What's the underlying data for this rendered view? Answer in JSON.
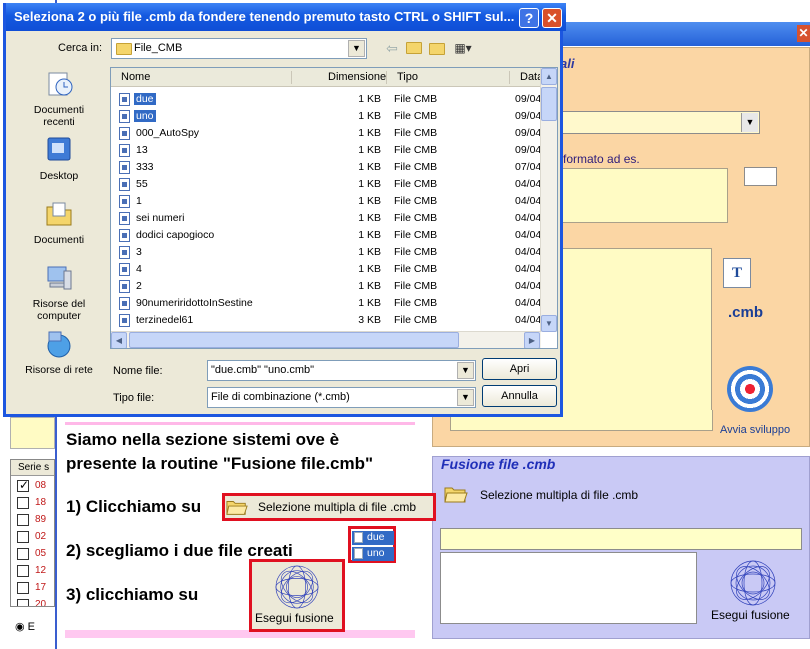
{
  "bg_app": {
    "orange_legend": "ali",
    "hint_text": "formato ad es.",
    "cmb_label": ".cmb",
    "avvia_label": "Avvia sviluppo",
    "fusione_legend": "Fusione file .cmb",
    "selezione_label": "Selezione multipla di file .cmb",
    "esegui_label": "Esegui fusione",
    "left_list_header": "Serie s",
    "left_list_rows": [
      "08",
      "18",
      "89",
      "02",
      "05",
      "12",
      "17",
      "20"
    ],
    "left_radio_label": "E"
  },
  "instructions": {
    "line1": "Siamo nella sezione sistemi ove è",
    "line2": "presente la routine \"Fusione file.cmb\"",
    "step1": "1) Clicchiamo su",
    "step1_button": "Selezione multipla di file .cmb",
    "step2": "2) scegliamo i due file creati",
    "step2_files": [
      "due",
      "uno"
    ],
    "step3": "3) clicchiamo su",
    "step3_button": "Esegui fusione"
  },
  "dialog": {
    "title": "Seleziona 2 o più file .cmb da fondere tenendo premuto tasto CTRL o SHIFT sul...",
    "cerca_label": "Cerca in:",
    "cerca_value": "File_CMB",
    "places": [
      "Documenti recenti",
      "Desktop",
      "Documenti",
      "Risorse del computer",
      "Risorse di rete"
    ],
    "columns": [
      "Nome",
      "Dimensione",
      "Tipo",
      "Data"
    ],
    "files": [
      {
        "name": "due",
        "size": "1 KB",
        "type": "File CMB",
        "date": "09/04",
        "selected": true
      },
      {
        "name": "uno",
        "size": "1 KB",
        "type": "File CMB",
        "date": "09/04",
        "selected": true
      },
      {
        "name": "000_AutoSpy",
        "size": "1 KB",
        "type": "File CMB",
        "date": "09/04",
        "selected": false
      },
      {
        "name": "13",
        "size": "1 KB",
        "type": "File CMB",
        "date": "09/04",
        "selected": false
      },
      {
        "name": "333",
        "size": "1 KB",
        "type": "File CMB",
        "date": "07/04",
        "selected": false
      },
      {
        "name": "55",
        "size": "1 KB",
        "type": "File CMB",
        "date": "04/04",
        "selected": false
      },
      {
        "name": "1",
        "size": "1 KB",
        "type": "File CMB",
        "date": "04/04",
        "selected": false
      },
      {
        "name": "sei numeri",
        "size": "1 KB",
        "type": "File CMB",
        "date": "04/04",
        "selected": false
      },
      {
        "name": "dodici capogioco",
        "size": "1 KB",
        "type": "File CMB",
        "date": "04/04",
        "selected": false
      },
      {
        "name": "3",
        "size": "1 KB",
        "type": "File CMB",
        "date": "04/04",
        "selected": false
      },
      {
        "name": "4",
        "size": "1 KB",
        "type": "File CMB",
        "date": "04/04",
        "selected": false
      },
      {
        "name": "2",
        "size": "1 KB",
        "type": "File CMB",
        "date": "04/04",
        "selected": false
      },
      {
        "name": "90numeriridottoInSestine",
        "size": "1 KB",
        "type": "File CMB",
        "date": "04/04",
        "selected": false
      },
      {
        "name": "terzinedel61",
        "size": "3 KB",
        "type": "File CMB",
        "date": "04/04",
        "selected": false
      }
    ],
    "nome_label": "Nome file:",
    "nome_value": "\"due.cmb\" \"uno.cmb\"",
    "tipo_label": "Tipo file:",
    "tipo_value": "File di combinazione (*.cmb)",
    "apri_label": "Apri",
    "annulla_label": "Annulla",
    "help_label": "?",
    "close_label": "✕"
  }
}
